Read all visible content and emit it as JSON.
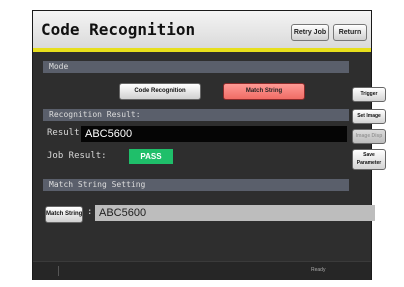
{
  "header": {
    "title": "Code Recognition",
    "retry_job_label": "Retry Job",
    "return_label": "Return"
  },
  "mode": {
    "section_label": "Mode",
    "buttons": [
      {
        "label": "Code Recognition",
        "selected": false
      },
      {
        "label": "Match String",
        "selected": true
      }
    ]
  },
  "side_buttons": {
    "trigger": "Trigger",
    "set_image": "Set Image",
    "image_disp": "Image Disp",
    "save_parameter_line1": "Save",
    "save_parameter_line2": "Parameter"
  },
  "recognition": {
    "section_label": "Recognition Result:",
    "result_label": "Result:",
    "result_value": "ABC5600",
    "job_result_label": "Job Result:",
    "job_result_value": "PASS"
  },
  "match": {
    "section_label": "Match String Setting",
    "button_label": "Match String",
    "separator": ":",
    "value": "ABC5600"
  },
  "footer": {
    "status": "Ready"
  },
  "colors": {
    "accent_yellow": "#e7df1c",
    "pass_green": "#1fbf6a",
    "selected_red": "#f06c65"
  }
}
